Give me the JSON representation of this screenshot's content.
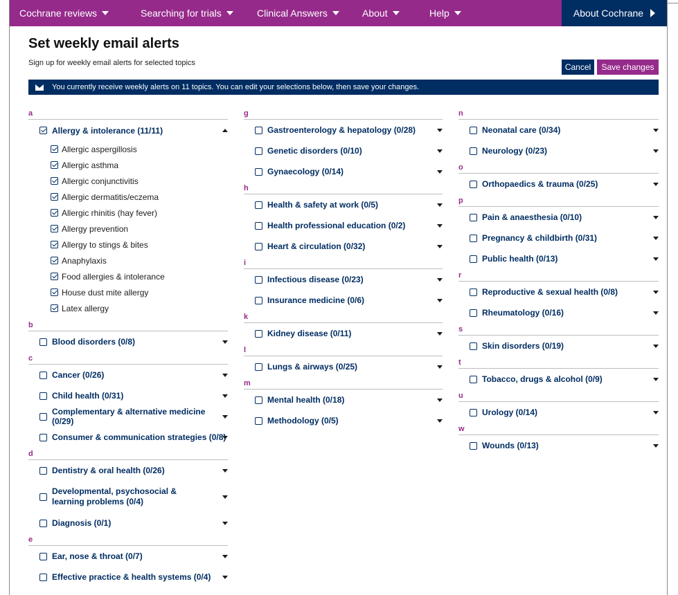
{
  "nav": {
    "items": [
      "Cochrane reviews",
      "Searching for trials",
      "Clinical Answers",
      "About",
      "Help"
    ],
    "about_cochrane": "About Cochrane"
  },
  "page": {
    "title": "Set weekly email alerts",
    "subtitle": "Sign up for weekly email alerts for selected topics",
    "cancel_label": "Cancel",
    "save_label": "Save changes",
    "banner": "You currently receive weekly alerts on 11 topics. You can edit your selections below, then save your changes."
  },
  "columns": [
    [
      {
        "letter": "a",
        "topics": [
          {
            "label": "Allergy & intolerance (11/11)",
            "checked": true,
            "expanded": true,
            "subtopics": [
              "Allergic aspergillosis",
              "Allergic asthma",
              "Allergic conjunctivitis",
              "Allergic dermatitis/eczema",
              "Allergic rhinitis (hay fever)",
              "Allergy prevention",
              "Allergy to stings & bites",
              "Anaphylaxis",
              "Food allergies & intolerance",
              "House dust mite allergy",
              "Latex allergy"
            ]
          }
        ]
      },
      {
        "letter": "b",
        "topics": [
          {
            "label": "Blood disorders (0/8)"
          }
        ]
      },
      {
        "letter": "c",
        "topics": [
          {
            "label": "Cancer (0/26)"
          },
          {
            "label": "Child health (0/31)"
          },
          {
            "label": "Complementary & alternative medicine (0/29)"
          },
          {
            "label": "Consumer & communication strategies (0/8)"
          }
        ]
      },
      {
        "letter": "d",
        "topics": [
          {
            "label": "Dentistry & oral health (0/26)"
          },
          {
            "label": "Developmental, psychosocial & learning problems (0/4)",
            "twoline": true
          },
          {
            "label": "Diagnosis (0/1)"
          }
        ]
      },
      {
        "letter": "e",
        "topics": [
          {
            "label": "Ear, nose & throat (0/7)"
          },
          {
            "label": "Effective practice & health systems (0/4)"
          }
        ]
      }
    ],
    [
      {
        "letter": "g",
        "topics": [
          {
            "label": "Gastroenterology & hepatology (0/28)"
          },
          {
            "label": "Genetic disorders (0/10)"
          },
          {
            "label": "Gynaecology (0/14)"
          }
        ]
      },
      {
        "letter": "h",
        "topics": [
          {
            "label": "Health & safety at work (0/5)"
          },
          {
            "label": "Health professional education (0/2)"
          },
          {
            "label": "Heart & circulation (0/32)"
          }
        ]
      },
      {
        "letter": "i",
        "topics": [
          {
            "label": "Infectious disease (0/23)"
          },
          {
            "label": "Insurance medicine (0/6)"
          }
        ]
      },
      {
        "letter": "k",
        "topics": [
          {
            "label": "Kidney disease (0/11)"
          }
        ]
      },
      {
        "letter": "l",
        "topics": [
          {
            "label": "Lungs & airways (0/25)"
          }
        ]
      },
      {
        "letter": "m",
        "topics": [
          {
            "label": "Mental health (0/18)"
          },
          {
            "label": "Methodology (0/5)"
          }
        ]
      }
    ],
    [
      {
        "letter": "n",
        "topics": [
          {
            "label": "Neonatal care (0/34)"
          },
          {
            "label": "Neurology (0/23)"
          }
        ]
      },
      {
        "letter": "o",
        "topics": [
          {
            "label": "Orthopaedics & trauma (0/25)"
          }
        ]
      },
      {
        "letter": "p",
        "topics": [
          {
            "label": "Pain & anaesthesia (0/10)"
          },
          {
            "label": "Pregnancy & childbirth (0/31)"
          },
          {
            "label": "Public health (0/13)"
          }
        ]
      },
      {
        "letter": "r",
        "topics": [
          {
            "label": "Reproductive & sexual health (0/8)"
          },
          {
            "label": "Rheumatology (0/16)"
          }
        ]
      },
      {
        "letter": "s",
        "topics": [
          {
            "label": "Skin disorders (0/19)"
          }
        ]
      },
      {
        "letter": "t",
        "topics": [
          {
            "label": "Tobacco, drugs & alcohol (0/9)"
          }
        ]
      },
      {
        "letter": "u",
        "topics": [
          {
            "label": "Urology (0/14)"
          }
        ]
      },
      {
        "letter": "w",
        "topics": [
          {
            "label": "Wounds (0/13)"
          }
        ]
      }
    ]
  ],
  "colors": {
    "purple": "#962a8b",
    "navy": "#002d62"
  }
}
